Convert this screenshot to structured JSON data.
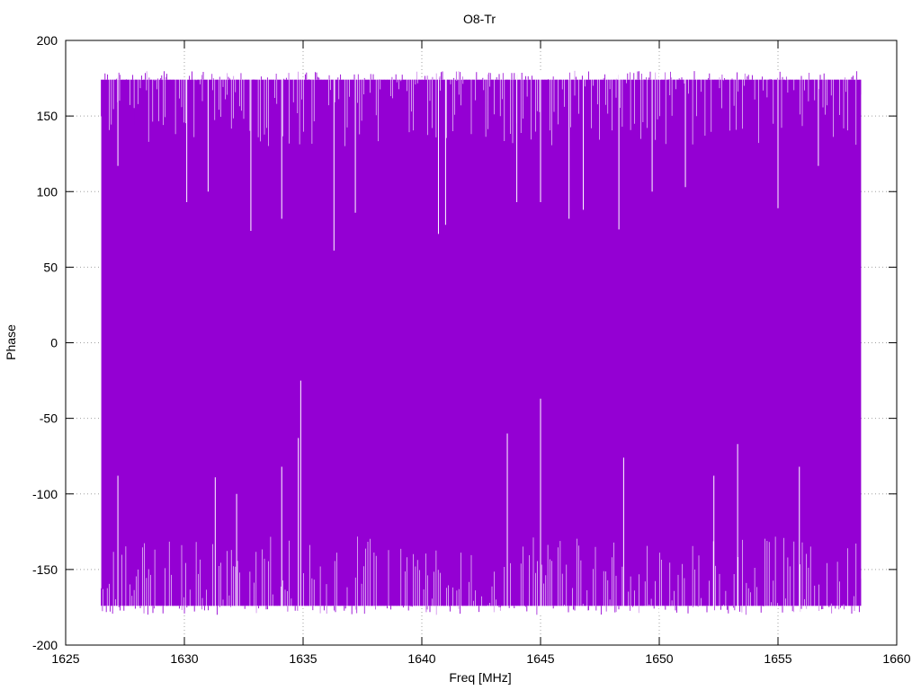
{
  "chart_data": {
    "type": "line",
    "title": "O8-Tr",
    "xlabel": "Freq [MHz]",
    "ylabel": "Phase",
    "xlim": [
      1625,
      1660
    ],
    "ylim": [
      -200,
      200
    ],
    "x_ticks": [
      "1625",
      "1630",
      "1635",
      "1640",
      "1645",
      "1650",
      "1655",
      "1660"
    ],
    "y_ticks": [
      "200",
      "150",
      "100",
      "50",
      "0",
      "-50",
      "-100",
      "-150",
      "-200"
    ],
    "grid": true,
    "legend": "none",
    "series": [
      {
        "color": "#9400d3",
        "x_range": [
          1626.5,
          1658.5
        ],
        "y_min_approx": -180,
        "y_max_approx": 180,
        "outliers_top": [
          {
            "x": 1627.2,
            "y": 117
          },
          {
            "x": 1630.1,
            "y": 93
          },
          {
            "x": 1631.0,
            "y": 100
          },
          {
            "x": 1632.8,
            "y": 74
          },
          {
            "x": 1634.1,
            "y": 82
          },
          {
            "x": 1636.3,
            "y": 61
          },
          {
            "x": 1637.2,
            "y": 86
          },
          {
            "x": 1640.7,
            "y": 72
          },
          {
            "x": 1641.0,
            "y": 78
          },
          {
            "x": 1644.0,
            "y": 93
          },
          {
            "x": 1645.0,
            "y": 93
          },
          {
            "x": 1646.2,
            "y": 82
          },
          {
            "x": 1646.8,
            "y": 88
          },
          {
            "x": 1648.3,
            "y": 75
          },
          {
            "x": 1649.7,
            "y": 100
          },
          {
            "x": 1651.1,
            "y": 103
          },
          {
            "x": 1655.0,
            "y": 89
          },
          {
            "x": 1656.7,
            "y": 117
          }
        ],
        "outliers_bottom": [
          {
            "x": 1627.2,
            "y": -88
          },
          {
            "x": 1631.3,
            "y": -89
          },
          {
            "x": 1632.2,
            "y": -100
          },
          {
            "x": 1634.1,
            "y": -82
          },
          {
            "x": 1634.8,
            "y": -63
          },
          {
            "x": 1634.9,
            "y": -25
          },
          {
            "x": 1643.6,
            "y": -60
          },
          {
            "x": 1645.0,
            "y": -37
          },
          {
            "x": 1648.5,
            "y": -76
          },
          {
            "x": 1652.3,
            "y": -88
          },
          {
            "x": 1653.3,
            "y": -67
          },
          {
            "x": 1655.9,
            "y": -82
          }
        ]
      }
    ]
  }
}
